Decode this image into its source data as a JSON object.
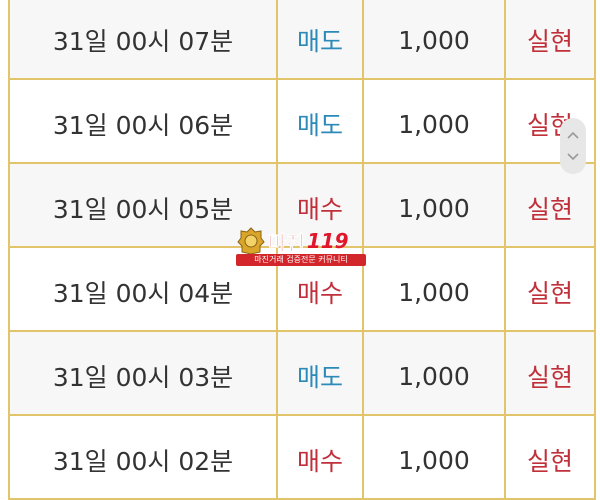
{
  "rows": [
    {
      "time": "31일 00시 07분",
      "type": "매도",
      "type_kind": "sell",
      "amount": "1,000",
      "result": "실현"
    },
    {
      "time": "31일 00시 06분",
      "type": "매도",
      "type_kind": "sell",
      "amount": "1,000",
      "result": "실현"
    },
    {
      "time": "31일 00시 05분",
      "type": "매수",
      "type_kind": "buy",
      "amount": "1,000",
      "result": "실현"
    },
    {
      "time": "31일 00시 04분",
      "type": "매수",
      "type_kind": "buy",
      "amount": "1,000",
      "result": "실현"
    },
    {
      "time": "31일 00시 03분",
      "type": "매도",
      "type_kind": "sell",
      "amount": "1,000",
      "result": "실현"
    },
    {
      "time": "31일 00시 02분",
      "type": "매수",
      "type_kind": "buy",
      "amount": "1,000",
      "result": "실현"
    }
  ],
  "scroll": {
    "up_icon": "chevron-up-icon",
    "down_icon": "chevron-down-icon"
  },
  "watermark": {
    "title": "마진",
    "number": "119",
    "tagline": "마진거래 검증전문 커뮤니티"
  },
  "colors": {
    "border": "#e2c46a",
    "sell": "#2b8ab8",
    "buy": "#c0303a",
    "result": "#c0303a",
    "row_alt": "#f7f7f7"
  }
}
